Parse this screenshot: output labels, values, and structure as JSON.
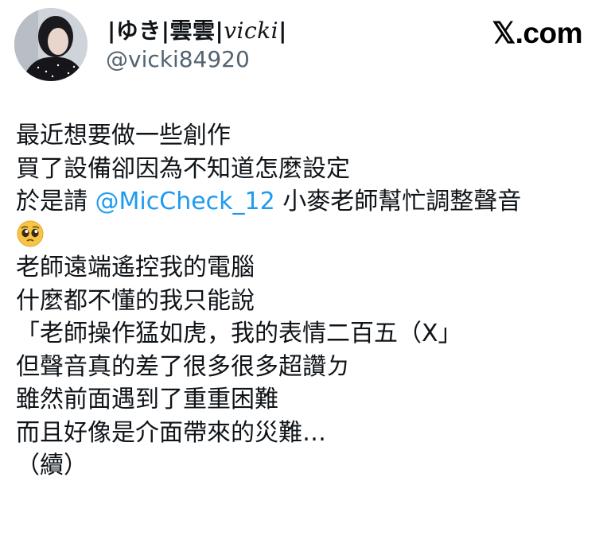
{
  "author": {
    "display_name_parts": [
      "|ゆき|雲雲|",
      "vicki",
      "|"
    ],
    "handle": "@vicki84920"
  },
  "brand": "𝕏.com",
  "tweet": {
    "line1": "最近想要做一些創作",
    "line2": "買了設備卻因為不知道怎麼設定",
    "line3_prefix": "於是請 ",
    "line3_mention": "@MicCheck_12",
    "line3_suffix": " 小麥老師幫忙調整聲音",
    "line4_emoji": "pleading-face-icon",
    "line5": "老師遠端遙控我的電腦",
    "line6": "什麼都不懂的我只能說",
    "line7": "「老師操作猛如虎，我的表情二百五（X」",
    "line8": "但聲音真的差了很多很多超讚ㄉ",
    "line9": "雖然前面遇到了重重困難",
    "line10": "而且好像是介面帶來的災難…",
    "line11": "（續）"
  },
  "colors": {
    "mention": "#1d9bf0",
    "handle": "#536471",
    "text": "#0f1419"
  }
}
